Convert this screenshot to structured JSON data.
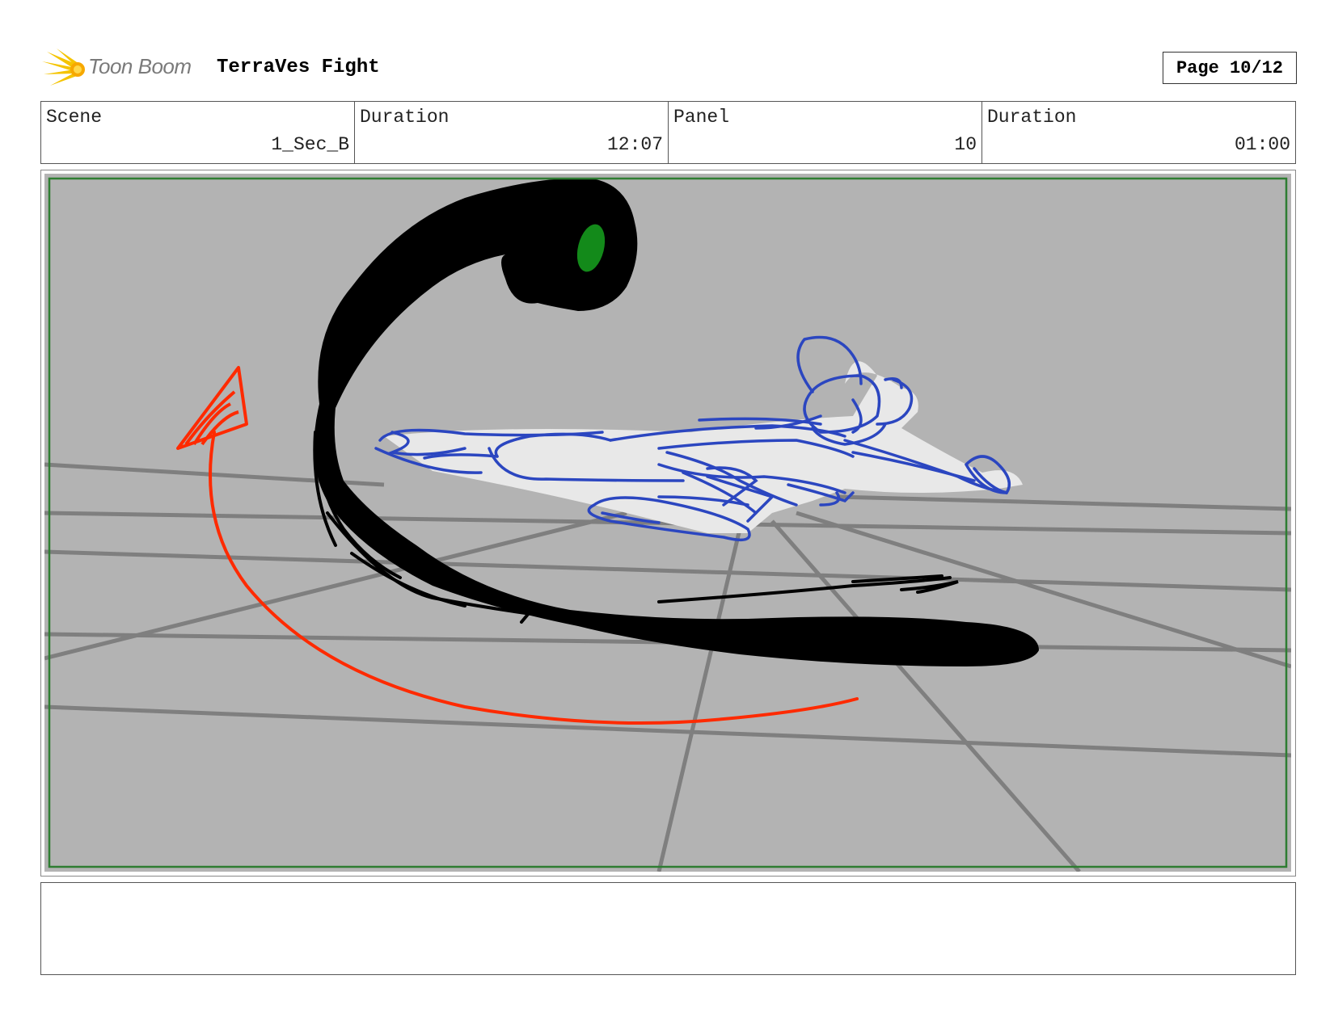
{
  "header": {
    "brand": "Toon Boom",
    "logo_icon": "toon-boom-starburst-icon",
    "title": "TerraVes Fight",
    "page": "Page 10/12"
  },
  "info": {
    "scene_label": "Scene",
    "scene_value": "1_Sec_B",
    "scene_duration_label": "Duration",
    "scene_duration_value": "12:07",
    "panel_label": "Panel",
    "panel_value": "10",
    "panel_duration_label": "Duration",
    "panel_duration_value": "01:00"
  },
  "panel": {
    "background_color": "#b3b3b3",
    "safe_frame_color": "#2e7d32",
    "grid_line_color": "#7f7f7f",
    "creature_color": "#000000",
    "eye_color": "#138a1a",
    "character_sketch_color": "#2b46c0",
    "motion_arrow_color": "#ff2a00"
  },
  "notes": {
    "text": ""
  }
}
